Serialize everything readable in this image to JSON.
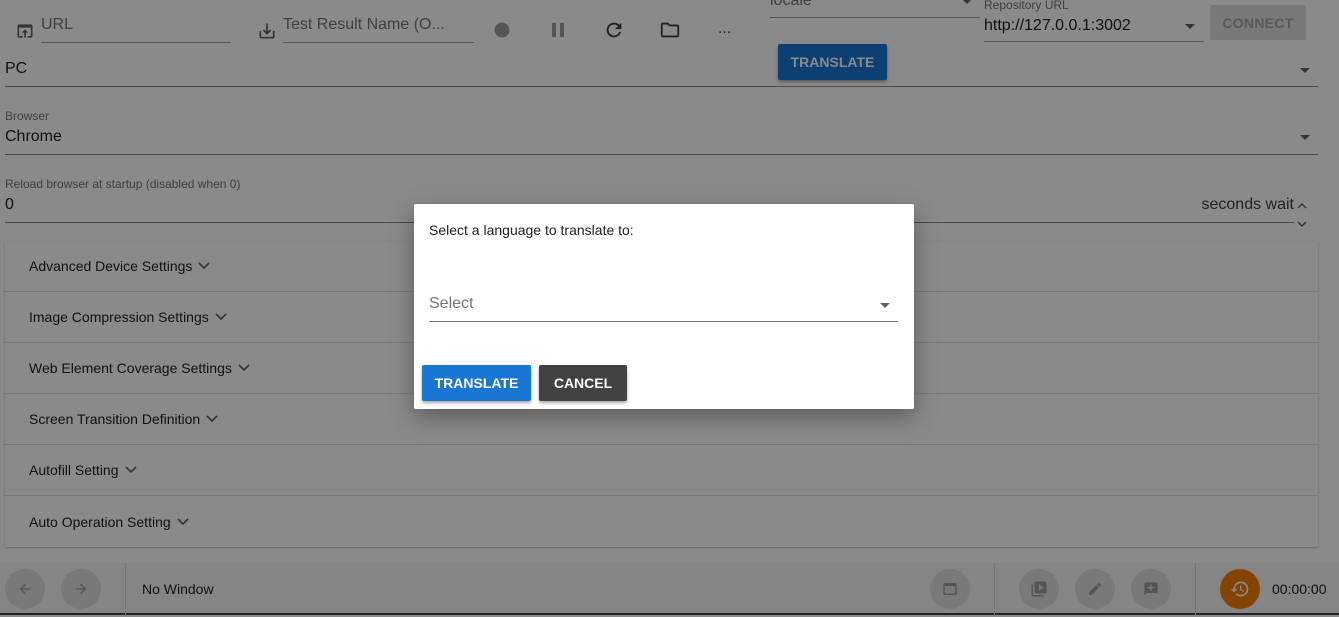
{
  "toolbar": {
    "url_placeholder": "URL",
    "test_result_placeholder": "Test Result Name (O...",
    "more_label": "...",
    "locale_placeholder": "locale",
    "translate_label": "TRANSLATE",
    "repository_label": "Repository URL",
    "repository_value": "http://127.0.0.1:3002",
    "connect_label": "CONNECT"
  },
  "settings": {
    "platform_value": "PC",
    "browser_label": "Browser",
    "browser_value": "Chrome",
    "reload_label": "Reload browser at startup (disabled when 0)",
    "reload_value": "0",
    "reload_suffix": "seconds wait",
    "sections": [
      "Advanced Device Settings",
      "Image Compression Settings",
      "Web Element Coverage Settings",
      "Screen Transition Definition",
      "Autofill Setting",
      "Auto Operation Setting"
    ]
  },
  "bottom_bar": {
    "window_label": "No Window",
    "timer": "00:00:00"
  },
  "dialog": {
    "title": "Select a language to translate to:",
    "select_placeholder": "Select",
    "translate_label": "TRANSLATE",
    "cancel_label": "CANCEL"
  },
  "colors": {
    "primary": "#1976d2",
    "accent_orange": "#f57c00",
    "dark_button": "#424242"
  }
}
